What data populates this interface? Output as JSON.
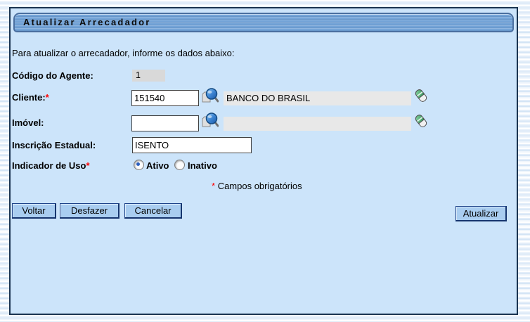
{
  "window": {
    "title": "Atualizar Arrecadador"
  },
  "intro": "Para atualizar o arrecadador, informe os dados abaixo:",
  "fields": {
    "codigo_agente": {
      "label": "Código do Agente:",
      "value": "1"
    },
    "cliente": {
      "label": "Cliente:",
      "required_mark": "*",
      "value": "151540",
      "display": "BANCO DO BRASIL"
    },
    "imovel": {
      "label": "Imóvel:",
      "value": "",
      "display": ""
    },
    "inscricao_estadual": {
      "label": "Inscrição Estadual:",
      "value": "ISENTO"
    },
    "indicador_uso": {
      "label": "Indicador de Uso",
      "required_mark": "*",
      "options": [
        {
          "label": "Ativo",
          "selected": true
        },
        {
          "label": "Inativo",
          "selected": false
        }
      ]
    }
  },
  "required_note": {
    "mark": "*",
    "text": "Campos obrigatórios"
  },
  "buttons": {
    "voltar": "Voltar",
    "desfazer": "Desfazer",
    "cancelar": "Cancelar",
    "atualizar": "Atualizar"
  },
  "icons": {
    "search": "magnifier-icon",
    "erase": "eraser-icon"
  },
  "colors": {
    "panel_bg": "#cce4fa",
    "titlebar_bg": "#74a4d8",
    "button_bg": "#a9cdf0",
    "required": "#ff0000",
    "readonly_bg": "#e8e8e8",
    "disabled_bg": "#d9d9d9"
  }
}
